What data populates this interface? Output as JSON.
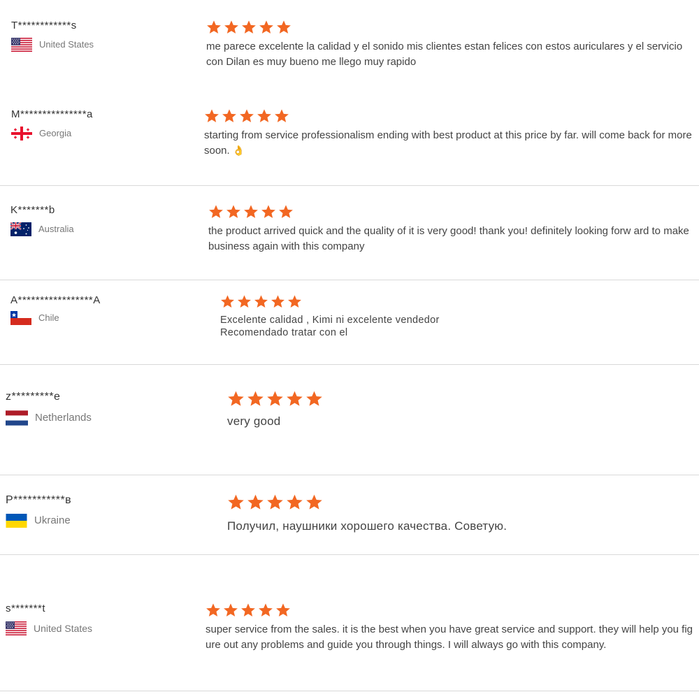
{
  "colors": {
    "star": "#f26722",
    "divider": "#d9d9d9"
  },
  "reviews": [
    {
      "reviewer": "T************s",
      "country": "United States",
      "flag": "us-flag-icon",
      "rating": 5,
      "text": "me parece excelente la calidad y el sonido mis clientes estan felices con estos auriculares y el servicio con Dilan es muy bueno me llego muy rapido"
    },
    {
      "reviewer": "M***************a",
      "country": "Georgia",
      "flag": "georgia-flag-icon",
      "rating": 5,
      "text": "starting from service professionalism ending with best product at this price by far. will come back for more soon.",
      "emoji": "👌"
    },
    {
      "reviewer": "K*******b",
      "country": "Australia",
      "flag": "australia-flag-icon",
      "rating": 5,
      "text": "the product arrived quick and the quality of it is very good! thank you! definitely looking forw ard to make business again with this company"
    },
    {
      "reviewer": "A*****************A",
      "country": "Chile",
      "flag": "chile-flag-icon",
      "rating": 5,
      "text_lines": [
        "Excelente calidad , Kimi ni excelente vendedor",
        "Recomendado tratar con el"
      ]
    },
    {
      "reviewer": "z*********e",
      "country": "Netherlands",
      "flag": "netherlands-flag-icon",
      "rating": 5,
      "text": "very good"
    },
    {
      "reviewer": "P***********в",
      "country": "Ukraine",
      "flag": "ukraine-flag-icon",
      "rating": 5,
      "text": "Получил, наушники хорошего качества. Советую."
    },
    {
      "reviewer": "s*******t",
      "country": "United States",
      "flag": "us-flag-icon",
      "rating": 5,
      "text": "super service from the sales. it is the best when you have great service and support. they will help you figure out any problems and guide you through things. I will always go with this company."
    }
  ]
}
